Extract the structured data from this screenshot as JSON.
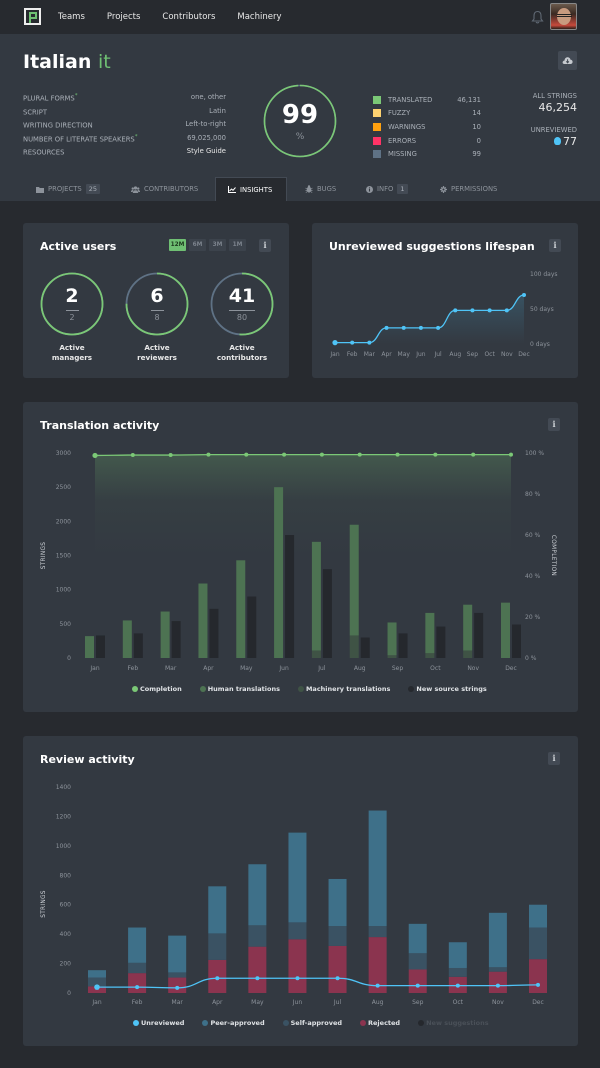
{
  "nav": {
    "logo": "Pontoon logo",
    "links": [
      "Teams",
      "Projects",
      "Contributors",
      "Machinery"
    ],
    "notifications_icon": "bell-icon",
    "avatar": "user-avatar"
  },
  "header": {
    "language_name": "Italian",
    "language_code": "it",
    "info": [
      {
        "key": "PLURAL FORMS",
        "asterisk": "*",
        "value": "one, other"
      },
      {
        "key": "SCRIPT",
        "asterisk": "",
        "value": "Latin"
      },
      {
        "key": "WRITING DIRECTION",
        "asterisk": "",
        "value": "Left-to-right"
      },
      {
        "key": "NUMBER OF LITERATE SPEAKERS",
        "asterisk": "*",
        "value": "69,025,000"
      },
      {
        "key": "RESOURCES",
        "asterisk": "",
        "value": "Style Guide"
      }
    ],
    "completion_percent": "99",
    "completion_symbol": "%",
    "completion_fraction": 0.99,
    "stats": [
      {
        "label": "TRANSLATED",
        "value": "46,131",
        "color": "#7bc876"
      },
      {
        "label": "FUZZY",
        "value": "14",
        "color": "#fed271"
      },
      {
        "label": "WARNINGS",
        "value": "10",
        "color": "#ffa10f"
      },
      {
        "label": "ERRORS",
        "value": "0",
        "color": "#f36"
      },
      {
        "label": "MISSING",
        "value": "99",
        "color": "#5f7285"
      }
    ],
    "all_strings_label": "ALL STRINGS",
    "all_strings_value": "46,254",
    "unreviewed_label": "UNREVIEWED",
    "unreviewed_value": "77",
    "download_icon": "cloud-download-icon"
  },
  "tabs": [
    {
      "label": "PROJECTS",
      "badge": "25",
      "icon": "folder-icon"
    },
    {
      "label": "CONTRIBUTORS",
      "badge": "",
      "icon": "users-icon"
    },
    {
      "label": "INSIGHTS",
      "badge": "",
      "icon": "chart-icon",
      "active": true
    },
    {
      "label": "BUGS",
      "badge": "",
      "icon": "bug-icon"
    },
    {
      "label": "INFO",
      "badge": "1",
      "icon": "info-circle-icon"
    },
    {
      "label": "PERMISSIONS",
      "badge": "",
      "icon": "gear-icon"
    }
  ],
  "active_users": {
    "title": "Active users",
    "periods": [
      "12M",
      "6M",
      "3M",
      "1M"
    ],
    "active_period": "12M",
    "info_label": "i",
    "items": [
      {
        "active": "2",
        "total": "2",
        "label_line1": "Active",
        "label_line2": "managers",
        "fraction": 1.0
      },
      {
        "active": "6",
        "total": "8",
        "label_line1": "Active",
        "label_line2": "reviewers",
        "fraction": 0.75
      },
      {
        "active": "41",
        "total": "80",
        "label_line1": "Active",
        "label_line2": "contributors",
        "fraction": 0.5125
      }
    ]
  },
  "lifespan": {
    "title": "Unreviewed suggestions lifespan",
    "info_label": "i"
  },
  "translation_activity": {
    "title": "Translation activity",
    "info_label": "i"
  },
  "review_activity": {
    "title": "Review activity",
    "info_label": "i"
  },
  "chart_data": [
    {
      "id": "lifespan",
      "type": "line",
      "title": "Unreviewed suggestions lifespan",
      "categories": [
        "Jan",
        "Feb",
        "Mar",
        "Apr",
        "May",
        "Jun",
        "Jul",
        "Aug",
        "Sep",
        "Oct",
        "Nov",
        "Dec"
      ],
      "series": [
        {
          "name": "Lifespan (days)",
          "values": [
            2,
            2,
            2,
            23,
            23,
            23,
            23,
            48,
            48,
            48,
            48,
            70
          ],
          "color": "#4fc4f7"
        }
      ],
      "y_ticks": [
        "0 days",
        "50 days",
        "100 days"
      ],
      "ylim": [
        0,
        100
      ],
      "y_axis_side": "right",
      "grid": false
    },
    {
      "id": "translation",
      "type": "bar",
      "title": "Translation activity",
      "categories": [
        "Jan",
        "Feb",
        "Mar",
        "Apr",
        "May",
        "Jun",
        "Jul",
        "Aug",
        "Sep",
        "Oct",
        "Nov",
        "Dec"
      ],
      "ylabel": "STRINGS",
      "y2label": "COMPLETION",
      "ylim": [
        0,
        3000
      ],
      "y_ticks": [
        "0",
        "500",
        "1000",
        "1500",
        "2000",
        "2500",
        "3000"
      ],
      "y2lim": [
        0,
        100
      ],
      "y2_ticks": [
        "0 %",
        "20 %",
        "40 %",
        "60 %",
        "80 %",
        "100 %"
      ],
      "series": [
        {
          "name": "Completion",
          "type": "line",
          "axis": "right",
          "values": [
            98.8,
            99,
            99,
            99.2,
            99.2,
            99.2,
            99.2,
            99.2,
            99.2,
            99.2,
            99.2,
            99.2
          ],
          "color": "#7bc876"
        },
        {
          "name": "Human translations",
          "type": "bar",
          "stack": "translations",
          "values": [
            320,
            550,
            680,
            1090,
            1430,
            2500,
            1590,
            1620,
            480,
            590,
            670,
            810
          ],
          "color": "#4d7352"
        },
        {
          "name": "Machinery translations",
          "type": "bar",
          "stack": "translations",
          "values": [
            0,
            0,
            0,
            0,
            0,
            0,
            110,
            330,
            40,
            70,
            110,
            0
          ],
          "color": "#3f5345"
        },
        {
          "name": "New source strings",
          "type": "bar",
          "values": [
            330,
            360,
            540,
            720,
            900,
            1800,
            1300,
            300,
            360,
            460,
            660,
            490
          ],
          "color": "#25282d"
        }
      ],
      "legend": [
        "Completion",
        "Human translations",
        "Machinery translations",
        "New source strings"
      ],
      "legend_position": "bottom"
    },
    {
      "id": "review",
      "type": "bar",
      "title": "Review activity",
      "categories": [
        "Jan",
        "Feb",
        "Mar",
        "Apr",
        "May",
        "Jun",
        "Jul",
        "Aug",
        "Sep",
        "Oct",
        "Nov",
        "Dec"
      ],
      "ylabel": "STRINGS",
      "ylim": [
        0,
        1400
      ],
      "y_ticks": [
        "0",
        "200",
        "400",
        "600",
        "800",
        "1000",
        "1200",
        "1400"
      ],
      "series": [
        {
          "name": "Unreviewed",
          "type": "line",
          "values": [
            40,
            40,
            35,
            100,
            100,
            100,
            100,
            50,
            50,
            50,
            50,
            55
          ],
          "color": "#4fc4f7"
        },
        {
          "name": "Peer-approved",
          "type": "bar",
          "stack": "review",
          "values": [
            50,
            240,
            250,
            320,
            415,
            610,
            320,
            785,
            200,
            175,
            370,
            155
          ],
          "color": "#3e7089"
        },
        {
          "name": "Self-approved",
          "type": "bar",
          "stack": "review",
          "values": [
            60,
            70,
            35,
            180,
            145,
            115,
            135,
            75,
            110,
            60,
            30,
            215
          ],
          "color": "#3a5263"
        },
        {
          "name": "Rejected",
          "type": "bar",
          "stack": "review",
          "values": [
            45,
            135,
            105,
            225,
            315,
            365,
            320,
            380,
            160,
            110,
            145,
            230
          ],
          "color": "#8b344f"
        },
        {
          "name": "New suggestions",
          "type": "bar",
          "hidden": true,
          "values": [],
          "color": "#25282d"
        }
      ],
      "legend": [
        "Unreviewed",
        "Peer-approved",
        "Self-approved",
        "Rejected",
        "New suggestions"
      ],
      "legend_position": "bottom"
    }
  ]
}
